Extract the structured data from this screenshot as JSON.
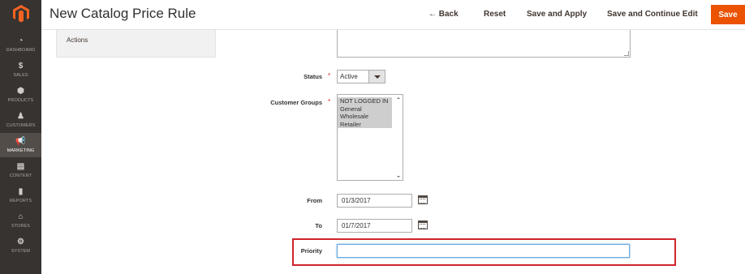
{
  "sidebar": {
    "logo_icon": "magento-logo",
    "items": [
      {
        "label": "DASHBOARD",
        "icon": "dashboard-icon",
        "glyph": "◔"
      },
      {
        "label": "SALES",
        "icon": "dollar-icon",
        "glyph": "$"
      },
      {
        "label": "PRODUCTS",
        "icon": "cube-icon",
        "glyph": "⬢"
      },
      {
        "label": "CUSTOMERS",
        "icon": "person-icon",
        "glyph": "♟"
      },
      {
        "label": "MARKETING",
        "icon": "megaphone-icon",
        "glyph": "📢"
      },
      {
        "label": "CONTENT",
        "icon": "content-icon",
        "glyph": "▤"
      },
      {
        "label": "REPORTS",
        "icon": "bar-chart-icon",
        "glyph": "▮"
      },
      {
        "label": "STORES",
        "icon": "store-icon",
        "glyph": "⌂"
      },
      {
        "label": "SYSTEM",
        "icon": "gear-icon",
        "glyph": "⚙"
      }
    ],
    "active": "MARKETING"
  },
  "header": {
    "title": "New Catalog Price Rule",
    "back_label": "← Back",
    "reset_label": "Reset",
    "save_apply_label": "Save and Apply",
    "save_continue_label": "Save and Continue Edit",
    "save_label": "Save",
    "accent_color": "#eb5202"
  },
  "tabs": {
    "actions_label": "Actions"
  },
  "form": {
    "status": {
      "label": "Status",
      "required": "*",
      "value": "Active"
    },
    "customer_groups": {
      "label": "Customer Groups",
      "required": "*",
      "options": [
        "NOT LOGGED IN",
        "General",
        "Wholesale",
        "Retailer"
      ]
    },
    "from": {
      "label": "From",
      "value": "01/3/2017"
    },
    "to": {
      "label": "To",
      "value": "01/7/2017"
    },
    "priority": {
      "label": "Priority",
      "value": ""
    }
  },
  "highlight_color": "#d0242b"
}
